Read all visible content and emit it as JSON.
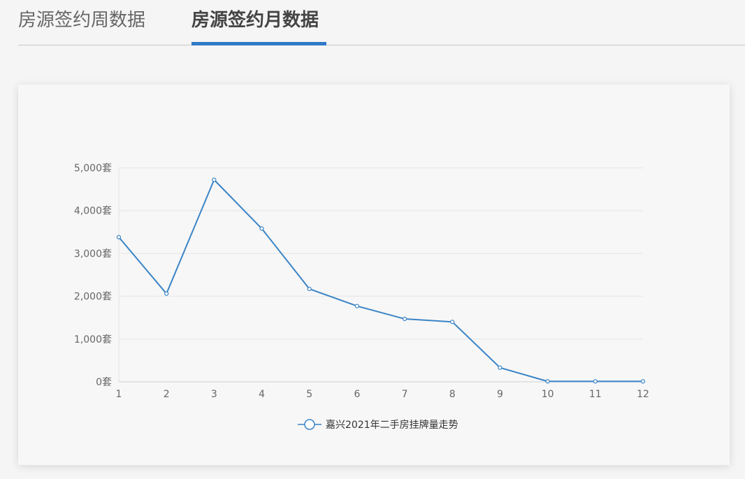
{
  "tabs": [
    {
      "label": "房源签约周数据",
      "active": false
    },
    {
      "label": "房源签约月数据",
      "active": true
    }
  ],
  "colors": {
    "accent": "#2f7ac8",
    "series": "#3a84c6"
  },
  "chart_data": {
    "type": "line",
    "x": [
      1,
      2,
      3,
      4,
      5,
      6,
      7,
      8,
      9,
      10,
      11,
      12
    ],
    "xticks": [
      "1",
      "2",
      "3",
      "4",
      "5",
      "6",
      "7",
      "8",
      "9",
      "10",
      "11",
      "12"
    ],
    "yticks": [
      "0套",
      "1,000套",
      "2,000套",
      "3,000套",
      "4,000套",
      "5,000套"
    ],
    "ylim": [
      0,
      5000
    ],
    "grid": true,
    "legend_position": "bottom-center",
    "series": [
      {
        "name": "嘉兴2021年二手房挂牌量走势",
        "values": [
          3380,
          2060,
          4720,
          3580,
          2170,
          1770,
          1470,
          1400,
          330,
          10,
          10,
          10
        ]
      }
    ]
  }
}
